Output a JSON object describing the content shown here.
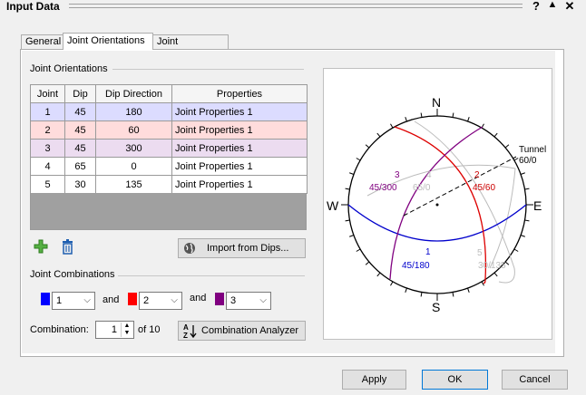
{
  "window": {
    "title": "Input Data",
    "help_glyph": "?",
    "collapse_glyph": "▲",
    "close_glyph": "✕"
  },
  "tabs": [
    {
      "label": "General"
    },
    {
      "label": "Joint Orientations"
    },
    {
      "label": "Joint Properties"
    }
  ],
  "joint_orientations": {
    "group_label": "Joint Orientations",
    "columns": [
      "Joint",
      "Dip",
      "Dip Direction",
      "Properties"
    ],
    "rows": [
      {
        "joint": "1",
        "dip": "45",
        "dip_direction": "180",
        "properties": "Joint Properties 1",
        "color": "#dcdcff"
      },
      {
        "joint": "2",
        "dip": "45",
        "dip_direction": "60",
        "properties": "Joint Properties 1",
        "color": "#ffdcdc"
      },
      {
        "joint": "3",
        "dip": "45",
        "dip_direction": "300",
        "properties": "Joint Properties 1",
        "color": "#ecdcf0"
      },
      {
        "joint": "4",
        "dip": "65",
        "dip_direction": "0",
        "properties": "Joint Properties 1",
        "color": "#ffffff"
      },
      {
        "joint": "5",
        "dip": "30",
        "dip_direction": "135",
        "properties": "Joint Properties 1",
        "color": "#ffffff"
      }
    ],
    "import_label": "Import from Dips..."
  },
  "joint_combinations": {
    "group_label": "Joint Combinations",
    "sel1": {
      "value": "1",
      "color": "#0000ff"
    },
    "sel2": {
      "value": "2",
      "color": "#ff0000"
    },
    "sel3": {
      "value": "3",
      "color": "#800080"
    },
    "and1": "and",
    "and2": "and",
    "combination_label": "Combination:",
    "combination_value": "1",
    "of_text": "of 10",
    "analyzer_label": "Combination Analyzer"
  },
  "stereonet": {
    "north": "N",
    "south": "S",
    "east": "E",
    "west": "W",
    "tunnel_label": "Tunnel",
    "tunnel_value": "60/0",
    "labels": [
      {
        "num": "1",
        "orient": "45/180",
        "color": "#0000cc"
      },
      {
        "num": "2",
        "orient": "45/60",
        "color": "#cc0000"
      },
      {
        "num": "3",
        "orient": "45/300",
        "color": "#800080"
      },
      {
        "num": "4",
        "orient": "65/0",
        "color": "#bbbbbb"
      },
      {
        "num": "5",
        "orient": "30/135",
        "color": "#bbbbbb"
      }
    ]
  },
  "footer": {
    "apply": "Apply",
    "ok": "OK",
    "cancel": "Cancel"
  }
}
